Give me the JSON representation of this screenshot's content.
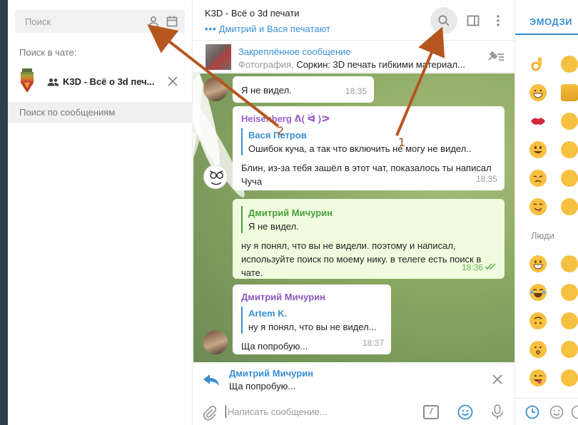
{
  "sidebar": {
    "search_placeholder": "Поиск",
    "search_in_chat_label": "Поиск в чате:",
    "chat_title": "K3D - Всё о 3d печ...",
    "search_messages_label": "Поиск по сообщениям"
  },
  "header": {
    "title": "K3D - Всё о 3d печати",
    "status": "Дмитрий и Вася печатают",
    "typing_dots": "•••"
  },
  "pinned": {
    "title": "Закреплённое сообщение",
    "prefix": "Фотография,",
    "text": "Соркин: 3D печать гибкими материал..."
  },
  "messages": [
    {
      "text": "Я не видел.",
      "time": "18:35"
    },
    {
      "author": "Heisenberg ᕕ( ᐛ )ᕗ",
      "reply_author": "Вася Петров",
      "reply_text": "Ошибок куча, а так что включить не могу не видел..",
      "text": "Блин, из-за тебя зашёл в этот чат, показалось ты написал Чуча",
      "time": "18:35"
    },
    {
      "reply_author": "Дмитрий Мичурин",
      "reply_text": "Я не видел.",
      "text": "ну я понял, что вы не видели. поэтому и написал, используйте поиск по моему нику. в телеге есть поиск в чате.",
      "time": "18:36"
    },
    {
      "author": "Дмитрий Мичурин",
      "reply_author": "Artem K.",
      "reply_text": "ну я понял, что вы не видел...",
      "text": "Ща попробую...",
      "time": "18:37"
    }
  ],
  "reply_bar": {
    "author": "Дмитрий Мичурин",
    "text": "Ща попробую..."
  },
  "compose": {
    "placeholder": "Написать сообщение...",
    "command_label": "/"
  },
  "emoji_panel": {
    "tab_label": "ЭМОДЗИ",
    "section_people": "Люди"
  },
  "annotations": {
    "label_1": "1",
    "label_2": "2",
    "arrow_color": "#b5561f"
  },
  "colors": {
    "accent": "#3a8fd3",
    "outgoing_bubble": "#effdde",
    "green_name": "#4a9e3f",
    "violet_name": "#8c58bf"
  }
}
